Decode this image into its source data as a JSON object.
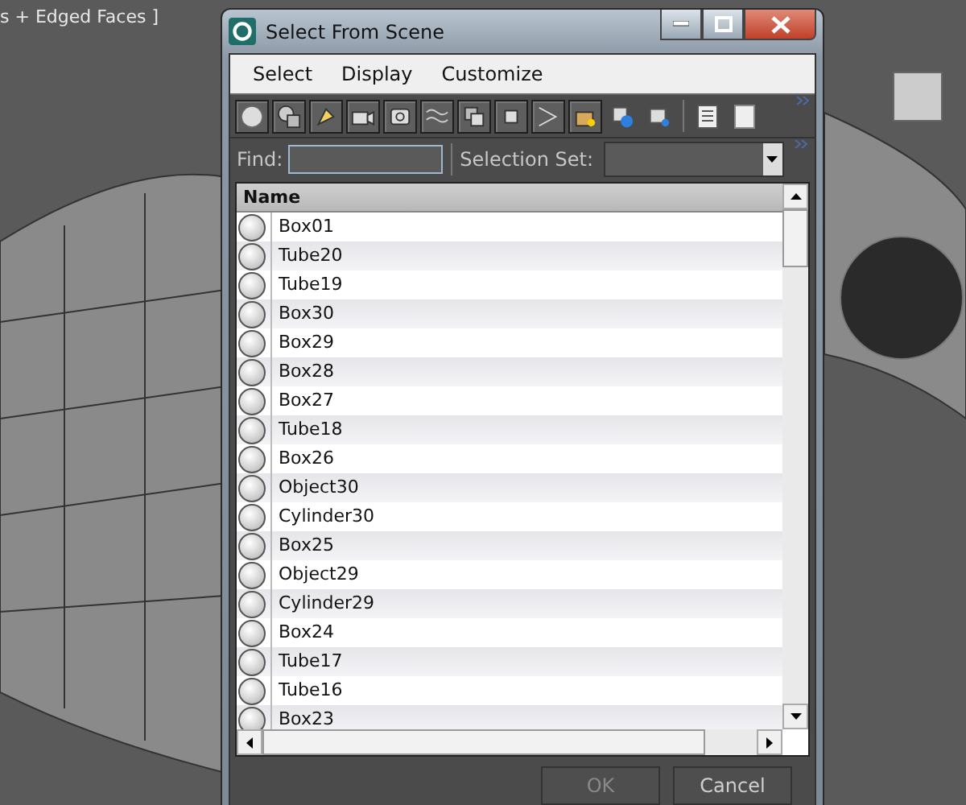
{
  "viewport": {
    "label": "s + Edged Faces ]"
  },
  "window": {
    "title": "Select From Scene"
  },
  "menu": [
    "Select",
    "Display",
    "Customize"
  ],
  "filters": [
    {
      "on": true
    },
    {
      "on": true
    },
    {
      "on": true
    },
    {
      "on": true
    },
    {
      "on": true
    },
    {
      "on": true
    },
    {
      "on": true
    },
    {
      "on": true
    },
    {
      "on": true
    },
    {
      "on": true
    },
    {
      "on": false
    },
    {
      "on": false
    }
  ],
  "find": {
    "label": "Find:"
  },
  "selection_set": {
    "label": "Selection Set:"
  },
  "list": {
    "column": "Name",
    "rows": [
      {
        "name": "Box01",
        "selected": false
      },
      {
        "name": "Tube20",
        "selected": false
      },
      {
        "name": "Tube19",
        "selected": false
      },
      {
        "name": "Box30",
        "selected": false
      },
      {
        "name": "Box29",
        "selected": false
      },
      {
        "name": "Box28",
        "selected": false
      },
      {
        "name": "Box27",
        "selected": false
      },
      {
        "name": "Tube18",
        "selected": false
      },
      {
        "name": "Box26",
        "selected": false
      },
      {
        "name": "Object30",
        "selected": false
      },
      {
        "name": "Cylinder30",
        "selected": false
      },
      {
        "name": "Box25",
        "selected": false
      },
      {
        "name": "Object29",
        "selected": false
      },
      {
        "name": "Cylinder29",
        "selected": false
      },
      {
        "name": "Box24",
        "selected": false
      },
      {
        "name": "Tube17",
        "selected": false
      },
      {
        "name": "Tube16",
        "selected": false
      },
      {
        "name": "Box23",
        "selected": false
      }
    ]
  },
  "buttons": [
    {
      "label": "OK",
      "disabled": true
    },
    {
      "label": "Cancel",
      "disabled": false
    }
  ]
}
